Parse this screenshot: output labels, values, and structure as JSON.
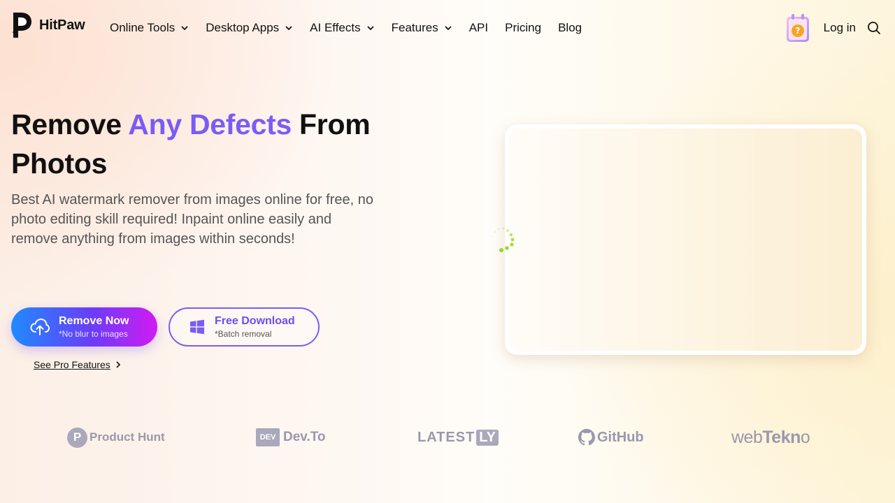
{
  "brand": {
    "name": "HitPaw",
    "accent_color": "#7a5cf5"
  },
  "nav": {
    "items": [
      {
        "label": "Online Tools",
        "has_dropdown": true
      },
      {
        "label": "Desktop Apps",
        "has_dropdown": true
      },
      {
        "label": "AI Effects",
        "has_dropdown": true
      },
      {
        "label": "Features",
        "has_dropdown": true
      },
      {
        "label": "API",
        "has_dropdown": false
      },
      {
        "label": "Pricing",
        "has_dropdown": false
      },
      {
        "label": "Blog",
        "has_dropdown": false
      }
    ],
    "login": "Log in",
    "icons": [
      "promo-gift-icon",
      "search-icon"
    ]
  },
  "hero": {
    "title_part1": "Remove ",
    "title_accent": "Any Defects",
    "title_part2": " From Photos",
    "description": "Best AI watermark remover from images online for free, no photo editing skill required! Inpaint online easily and remove anything from images within seconds!",
    "primary_button": {
      "label": "Remove Now",
      "sublabel": "*No blur to images",
      "icon": "cloud-upload-icon"
    },
    "secondary_button": {
      "label": "Free Download",
      "sublabel": "*Batch removal",
      "icon": "windows-icon"
    },
    "pro_link": "See Pro Features"
  },
  "preview": {
    "state": "loading",
    "spinner_color": "#9be03a"
  },
  "partners": {
    "product_hunt": {
      "initial": "P",
      "label": "Product Hunt"
    },
    "dev_to": {
      "badge": "DEV",
      "label": "Dev.To"
    },
    "latestly": {
      "prefix": "LATEST",
      "suffix": "LY"
    },
    "github": {
      "label": "GitHub"
    },
    "webtekno": {
      "part1": "web",
      "part2": "Tekn",
      "part3": "o"
    }
  }
}
